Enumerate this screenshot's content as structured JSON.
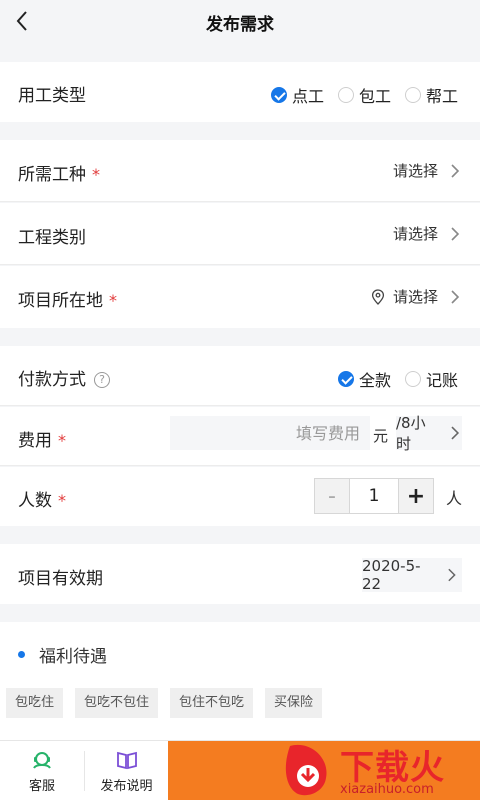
{
  "header": {
    "title": "发布需求"
  },
  "work_type": {
    "label": "用工类型",
    "options": [
      {
        "label": "点工",
        "selected": true
      },
      {
        "label": "包工",
        "selected": false
      },
      {
        "label": "帮工",
        "selected": false
      }
    ]
  },
  "trade": {
    "label": "所需工种",
    "required_mark": "*",
    "value": "请选择"
  },
  "project_category": {
    "label": "工程类别",
    "value": "请选择"
  },
  "location": {
    "label": "项目所在地",
    "required_mark": "*",
    "value": "请选择"
  },
  "payment": {
    "label": "付款方式",
    "help_icon": "?",
    "options": [
      {
        "label": "全款",
        "selected": true
      },
      {
        "label": "记账",
        "selected": false
      }
    ]
  },
  "fee": {
    "label": "费用",
    "required_mark": "*",
    "placeholder": "填写费用",
    "unit": "元",
    "period": "/8小时"
  },
  "headcount": {
    "label": "人数",
    "required_mark": "*",
    "minus": "-",
    "value": "1",
    "plus": "+",
    "unit": "人"
  },
  "validity": {
    "label": "项目有效期",
    "value": "2020-5-22"
  },
  "welfare": {
    "title": "福利待遇",
    "tags": [
      "包吃住",
      "包吃不包住",
      "包住不包吃",
      "买保险"
    ]
  },
  "bottom": {
    "service_label": "客服",
    "guide_label": "发布说明"
  },
  "watermark": {
    "text": "下载火",
    "sub": "xiazaihuo.com"
  },
  "colors": {
    "accent": "#1677e8",
    "submit": "#f47c20",
    "required": "#e23b3b"
  }
}
